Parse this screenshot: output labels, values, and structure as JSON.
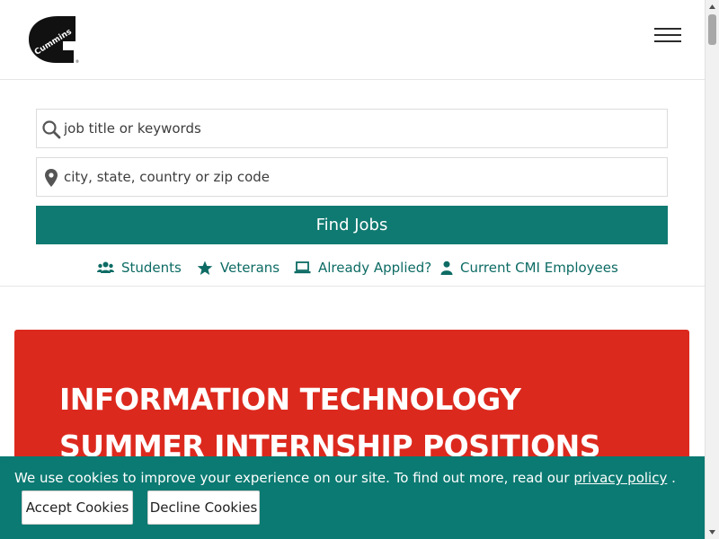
{
  "header": {
    "logo_text": "Cummins",
    "logo_alt": "Cummins logo",
    "menu_label": "menu"
  },
  "search": {
    "keyword_placeholder": "job title or keywords",
    "location_placeholder": "city, state, country or zip code",
    "find_button": "Find Jobs"
  },
  "quick_links": [
    {
      "label": "Students",
      "icon": "users-icon"
    },
    {
      "label": "Veterans",
      "icon": "star-icon"
    },
    {
      "label": "Already Applied?",
      "icon": "laptop-icon"
    },
    {
      "label": "Current CMI Employees",
      "icon": "user-icon"
    }
  ],
  "hero": {
    "title_line1": "INFORMATION TECHNOLOGY",
    "title_line2": "SUMMER INTERNSHIP POSITIONS"
  },
  "cookie": {
    "text": "We use cookies to improve your experience on our site. To find out more, read our",
    "link": "privacy policy",
    "end": ".",
    "accept": "Accept Cookies",
    "decline": "Decline Cookies"
  },
  "colors": {
    "brand_teal": "#0f7a71",
    "hero_red": "#dc291e",
    "link_teal": "#0d6b64"
  }
}
